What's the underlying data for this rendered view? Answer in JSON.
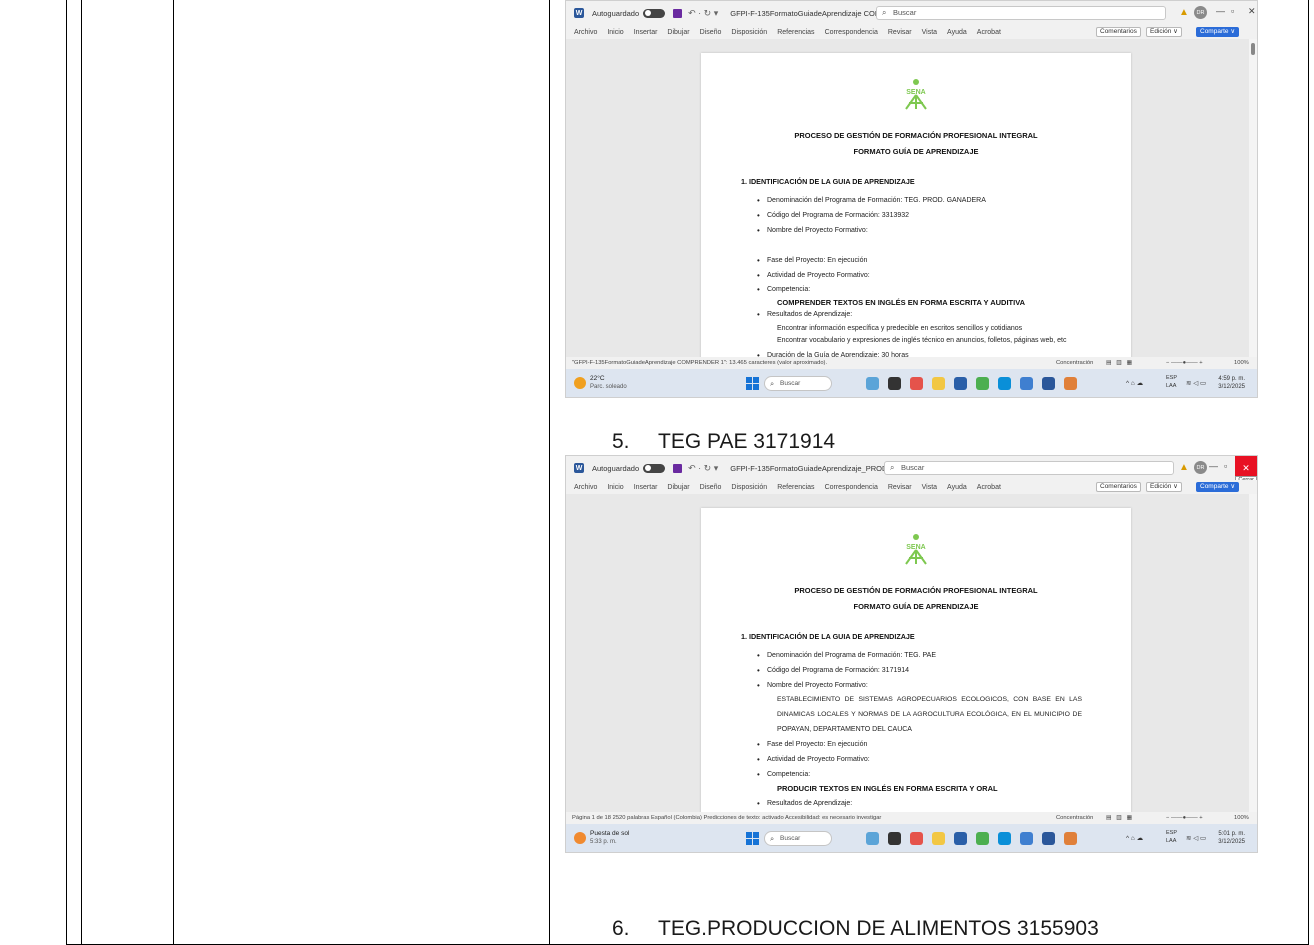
{
  "list": [
    {
      "number": "5.",
      "text": "TEG PAE 3171914"
    },
    {
      "number": "6.",
      "text": "TEG.PRODUCCION DE ALIMENTOS 3155903"
    }
  ],
  "screenshots": [
    {
      "titlebar": {
        "autosave": "Autoguardado",
        "doc_name": "GFPI-F-135FormatoGuiadeAprendizaje COMPRENDER 1 • Guardado ∨",
        "search": "Buscar",
        "avatar": "DR",
        "tooltip": ""
      },
      "menu": [
        "Archivo",
        "Inicio",
        "Insertar",
        "Dibujar",
        "Diseño",
        "Disposición",
        "Referencias",
        "Correspondencia",
        "Revisar",
        "Vista",
        "Ayuda",
        "Acrobat"
      ],
      "menu_right": {
        "comments": "Comentarios",
        "edit": "Edición ∨",
        "share": "Comparte ∨"
      },
      "page": {
        "logo": "SENA",
        "title1": "PROCESO DE GESTIÓN DE FORMACIÓN PROFESIONAL INTEGRAL",
        "title2": "FORMATO GUÍA DE APRENDIZAJE",
        "section": "1. IDENTIFICACIÓN DE LA GUIA DE APRENDIZAJE",
        "bullets": [
          "Denominación del Programa de Formación: TEG. PROD. GANADERA",
          "Código del Programa de Formación: 3313932",
          "Nombre del Proyecto Formativo:",
          "Fase del Proyecto: En ejecución",
          "Actividad de Proyecto Formativo:",
          "Competencia:",
          "Resultados de Aprendizaje:",
          "Duración de la Guía de Aprendizaje: 30 horas"
        ],
        "competencia": "COMPRENDER TEXTOS EN INGLÉS EN FORMA ESCRITA Y AUDITIVA",
        "resultados": [
          "Encontrar información específica y predecible en escritos sencillos y cotidianos",
          "Encontrar vocabulario y expresiones de inglés técnico en anuncios, folletos, páginas web, etc"
        ]
      },
      "statusbar": {
        "left": "\"GFPI-F-135FormatoGuiadeAprendizaje COMPRENDER 1\": 13.465 caracteres (valor aproximado).",
        "focus": "Concentración",
        "zoom": "100%"
      },
      "taskbar": {
        "weather_temp": "22°C",
        "weather_desc": "Parc. soleado",
        "search": "Buscar",
        "lang1": "ESP",
        "lang2": "LAA",
        "time": "4:59 p. m.",
        "date": "3/12/2025"
      }
    },
    {
      "titlebar": {
        "autosave": "Autoguardado",
        "doc_name": "GFPI-F-135FormatoGuiadeAprendizaje_PRODU... ∨",
        "search": "Buscar",
        "avatar": "DR",
        "tooltip": "Cerrar"
      },
      "menu": [
        "Archivo",
        "Inicio",
        "Insertar",
        "Dibujar",
        "Diseño",
        "Disposición",
        "Referencias",
        "Correspondencia",
        "Revisar",
        "Vista",
        "Ayuda",
        "Acrobat"
      ],
      "menu_right": {
        "comments": "Comentarios",
        "edit": "Edición ∨",
        "share": "Comparte ∨"
      },
      "page": {
        "logo": "SENA",
        "title1": "PROCESO DE GESTIÓN DE FORMACIÓN PROFESIONAL INTEGRAL",
        "title2": "FORMATO GUÍA DE APRENDIZAJE",
        "section": "1. IDENTIFICACIÓN DE LA GUIA DE APRENDIZAJE",
        "bullets": [
          "Denominación del Programa de Formación: TEG. PAE",
          "Código del Programa de Formación: 3171914",
          "Nombre del Proyecto Formativo:",
          "Fase del Proyecto: En ejecución",
          "Actividad de Proyecto Formativo:",
          "Competencia:",
          "Resultados de Aprendizaje:"
        ],
        "proyecto": [
          "ESTABLECIMIENTO DE SISTEMAS AGROPECUARIOS ECOLOGICOS, CON BASE EN LAS",
          "DINAMICAS LOCALES Y NORMAS DE LA AGROCULTURA ECOLÓGICA, EN EL MUNICIPIO DE",
          "POPAYAN, DEPARTAMENTO DEL CAUCA"
        ],
        "competencia": "PRODUCIR TEXTOS EN INGLÉS EN FORMA ESCRITA Y ORAL"
      },
      "statusbar": {
        "left": "Página 1 de 18   2520 palabras   Español (Colombia)   Predicciones de texto: activado   Accesibilidad: es necesario investigar",
        "focus": "Concentración",
        "zoom": "100%"
      },
      "taskbar": {
        "weather_temp": "Puesta de sol",
        "weather_desc": "5:33 p. m.",
        "search": "Buscar",
        "lang1": "ESP",
        "lang2": "LAA",
        "time": "5:01 p. m.",
        "date": "3/12/2025"
      }
    }
  ]
}
